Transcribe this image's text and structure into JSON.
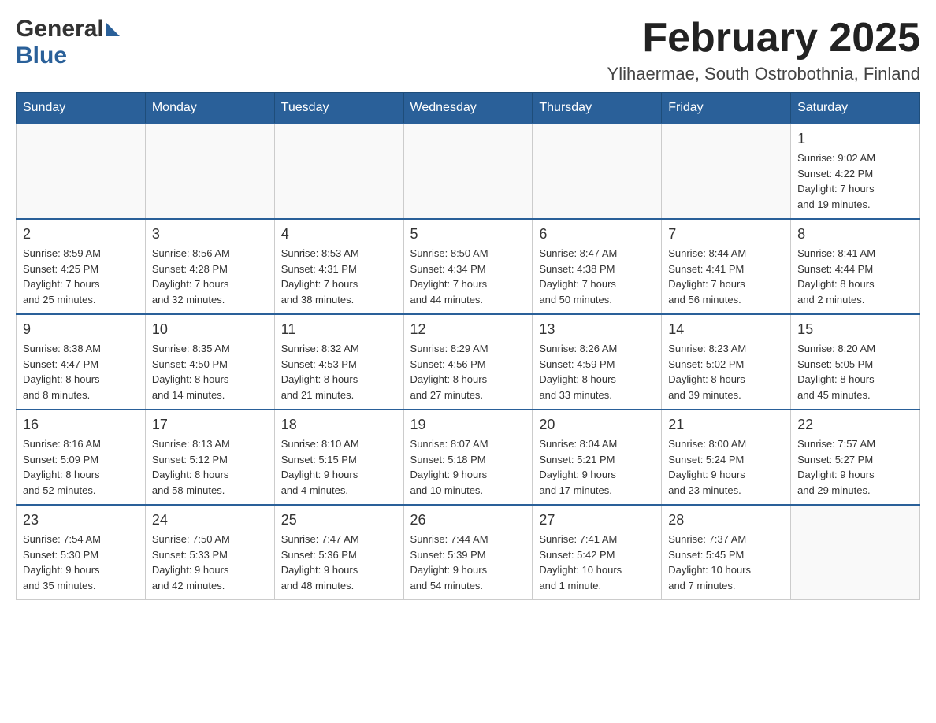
{
  "header": {
    "logo_general": "General",
    "logo_blue": "Blue",
    "month_title": "February 2025",
    "location": "Ylihaermae, South Ostrobothnia, Finland"
  },
  "weekdays": [
    "Sunday",
    "Monday",
    "Tuesday",
    "Wednesday",
    "Thursday",
    "Friday",
    "Saturday"
  ],
  "weeks": [
    [
      {
        "day": "",
        "info": ""
      },
      {
        "day": "",
        "info": ""
      },
      {
        "day": "",
        "info": ""
      },
      {
        "day": "",
        "info": ""
      },
      {
        "day": "",
        "info": ""
      },
      {
        "day": "",
        "info": ""
      },
      {
        "day": "1",
        "info": "Sunrise: 9:02 AM\nSunset: 4:22 PM\nDaylight: 7 hours\nand 19 minutes."
      }
    ],
    [
      {
        "day": "2",
        "info": "Sunrise: 8:59 AM\nSunset: 4:25 PM\nDaylight: 7 hours\nand 25 minutes."
      },
      {
        "day": "3",
        "info": "Sunrise: 8:56 AM\nSunset: 4:28 PM\nDaylight: 7 hours\nand 32 minutes."
      },
      {
        "day": "4",
        "info": "Sunrise: 8:53 AM\nSunset: 4:31 PM\nDaylight: 7 hours\nand 38 minutes."
      },
      {
        "day": "5",
        "info": "Sunrise: 8:50 AM\nSunset: 4:34 PM\nDaylight: 7 hours\nand 44 minutes."
      },
      {
        "day": "6",
        "info": "Sunrise: 8:47 AM\nSunset: 4:38 PM\nDaylight: 7 hours\nand 50 minutes."
      },
      {
        "day": "7",
        "info": "Sunrise: 8:44 AM\nSunset: 4:41 PM\nDaylight: 7 hours\nand 56 minutes."
      },
      {
        "day": "8",
        "info": "Sunrise: 8:41 AM\nSunset: 4:44 PM\nDaylight: 8 hours\nand 2 minutes."
      }
    ],
    [
      {
        "day": "9",
        "info": "Sunrise: 8:38 AM\nSunset: 4:47 PM\nDaylight: 8 hours\nand 8 minutes."
      },
      {
        "day": "10",
        "info": "Sunrise: 8:35 AM\nSunset: 4:50 PM\nDaylight: 8 hours\nand 14 minutes."
      },
      {
        "day": "11",
        "info": "Sunrise: 8:32 AM\nSunset: 4:53 PM\nDaylight: 8 hours\nand 21 minutes."
      },
      {
        "day": "12",
        "info": "Sunrise: 8:29 AM\nSunset: 4:56 PM\nDaylight: 8 hours\nand 27 minutes."
      },
      {
        "day": "13",
        "info": "Sunrise: 8:26 AM\nSunset: 4:59 PM\nDaylight: 8 hours\nand 33 minutes."
      },
      {
        "day": "14",
        "info": "Sunrise: 8:23 AM\nSunset: 5:02 PM\nDaylight: 8 hours\nand 39 minutes."
      },
      {
        "day": "15",
        "info": "Sunrise: 8:20 AM\nSunset: 5:05 PM\nDaylight: 8 hours\nand 45 minutes."
      }
    ],
    [
      {
        "day": "16",
        "info": "Sunrise: 8:16 AM\nSunset: 5:09 PM\nDaylight: 8 hours\nand 52 minutes."
      },
      {
        "day": "17",
        "info": "Sunrise: 8:13 AM\nSunset: 5:12 PM\nDaylight: 8 hours\nand 58 minutes."
      },
      {
        "day": "18",
        "info": "Sunrise: 8:10 AM\nSunset: 5:15 PM\nDaylight: 9 hours\nand 4 minutes."
      },
      {
        "day": "19",
        "info": "Sunrise: 8:07 AM\nSunset: 5:18 PM\nDaylight: 9 hours\nand 10 minutes."
      },
      {
        "day": "20",
        "info": "Sunrise: 8:04 AM\nSunset: 5:21 PM\nDaylight: 9 hours\nand 17 minutes."
      },
      {
        "day": "21",
        "info": "Sunrise: 8:00 AM\nSunset: 5:24 PM\nDaylight: 9 hours\nand 23 minutes."
      },
      {
        "day": "22",
        "info": "Sunrise: 7:57 AM\nSunset: 5:27 PM\nDaylight: 9 hours\nand 29 minutes."
      }
    ],
    [
      {
        "day": "23",
        "info": "Sunrise: 7:54 AM\nSunset: 5:30 PM\nDaylight: 9 hours\nand 35 minutes."
      },
      {
        "day": "24",
        "info": "Sunrise: 7:50 AM\nSunset: 5:33 PM\nDaylight: 9 hours\nand 42 minutes."
      },
      {
        "day": "25",
        "info": "Sunrise: 7:47 AM\nSunset: 5:36 PM\nDaylight: 9 hours\nand 48 minutes."
      },
      {
        "day": "26",
        "info": "Sunrise: 7:44 AM\nSunset: 5:39 PM\nDaylight: 9 hours\nand 54 minutes."
      },
      {
        "day": "27",
        "info": "Sunrise: 7:41 AM\nSunset: 5:42 PM\nDaylight: 10 hours\nand 1 minute."
      },
      {
        "day": "28",
        "info": "Sunrise: 7:37 AM\nSunset: 5:45 PM\nDaylight: 10 hours\nand 7 minutes."
      },
      {
        "day": "",
        "info": ""
      }
    ]
  ]
}
